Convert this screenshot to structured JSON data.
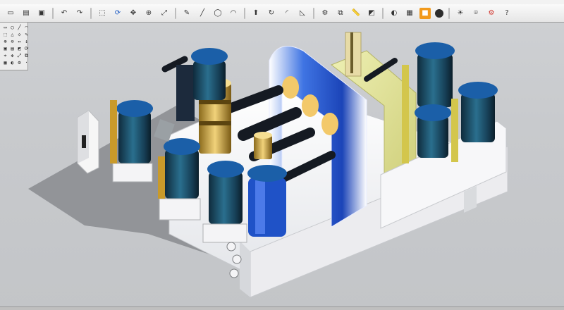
{
  "toolbar": {
    "buttons": [
      {
        "name": "new-file-icon",
        "glyph": "▭",
        "tone": "normal"
      },
      {
        "name": "open-file-icon",
        "glyph": "▤",
        "tone": "normal"
      },
      {
        "name": "save-icon",
        "glyph": "▣",
        "tone": "normal"
      },
      {
        "name": "sep",
        "glyph": "",
        "tone": "sep"
      },
      {
        "name": "undo-icon",
        "glyph": "↶",
        "tone": "normal"
      },
      {
        "name": "redo-icon",
        "glyph": "↷",
        "tone": "normal"
      },
      {
        "name": "sep",
        "glyph": "",
        "tone": "sep"
      },
      {
        "name": "select-icon",
        "glyph": "⬚",
        "tone": "normal"
      },
      {
        "name": "rotate-view-icon",
        "glyph": "⟳",
        "tone": "blue"
      },
      {
        "name": "pan-icon",
        "glyph": "✥",
        "tone": "normal"
      },
      {
        "name": "zoom-icon",
        "glyph": "⊕",
        "tone": "normal"
      },
      {
        "name": "zoom-fit-icon",
        "glyph": "⤢",
        "tone": "normal"
      },
      {
        "name": "sep",
        "glyph": "",
        "tone": "sep"
      },
      {
        "name": "sketch-icon",
        "glyph": "✎",
        "tone": "normal"
      },
      {
        "name": "line-icon",
        "glyph": "╱",
        "tone": "normal"
      },
      {
        "name": "circle-icon",
        "glyph": "◯",
        "tone": "normal"
      },
      {
        "name": "arc-icon",
        "glyph": "◠",
        "tone": "normal"
      },
      {
        "name": "sep",
        "glyph": "",
        "tone": "sep"
      },
      {
        "name": "extrude-icon",
        "glyph": "⬆",
        "tone": "normal"
      },
      {
        "name": "revolve-icon",
        "glyph": "↻",
        "tone": "normal"
      },
      {
        "name": "fillet-icon",
        "glyph": "◜",
        "tone": "normal"
      },
      {
        "name": "chamfer-icon",
        "glyph": "◺",
        "tone": "normal"
      },
      {
        "name": "sep",
        "glyph": "",
        "tone": "sep"
      },
      {
        "name": "assembly-icon",
        "glyph": "⚙",
        "tone": "normal"
      },
      {
        "name": "mate-icon",
        "glyph": "⧉",
        "tone": "normal"
      },
      {
        "name": "measure-icon",
        "glyph": "📏",
        "tone": "normal"
      },
      {
        "name": "section-view-icon",
        "glyph": "◩",
        "tone": "normal"
      },
      {
        "name": "sep",
        "glyph": "",
        "tone": "sep"
      },
      {
        "name": "render-icon",
        "glyph": "◐",
        "tone": "normal"
      },
      {
        "name": "material-icon",
        "glyph": "▦",
        "tone": "normal"
      },
      {
        "name": "shaded-icon",
        "glyph": "■",
        "tone": "orange"
      },
      {
        "name": "display-style-icon",
        "glyph": "",
        "tone": "dark"
      },
      {
        "name": "sep",
        "glyph": "",
        "tone": "sep"
      },
      {
        "name": "lights-icon",
        "glyph": "☀",
        "tone": "normal"
      },
      {
        "name": "camera-icon",
        "glyph": "⌾",
        "tone": "normal"
      },
      {
        "name": "options-icon",
        "glyph": "⚙",
        "tone": "red"
      },
      {
        "name": "help-icon",
        "glyph": "?",
        "tone": "normal"
      }
    ]
  },
  "palette": {
    "cells": [
      "▭",
      "◯",
      "╱",
      "◠",
      "⬚",
      "△",
      "◇",
      "✎",
      "⊕",
      "⊖",
      "↔",
      "↕",
      "▣",
      "▤",
      "◩",
      "⟳",
      "⌖",
      "✥",
      "⤢",
      "⧉",
      "▦",
      "◐",
      "⚙",
      "·"
    ]
  },
  "viewport": {
    "background": "#c8cacd",
    "model": "hydraulic-valve-assembly",
    "colors": {
      "base": "#f4f4f6",
      "blue_frame": "#2c5fd8",
      "valve_blue": "#1b5fa8",
      "valve_dark": "#163a52",
      "brass": "#c9a23a",
      "yellow_panel": "#e1e199",
      "black_pipe": "#151a22",
      "shadow": "#8c8e92"
    }
  }
}
